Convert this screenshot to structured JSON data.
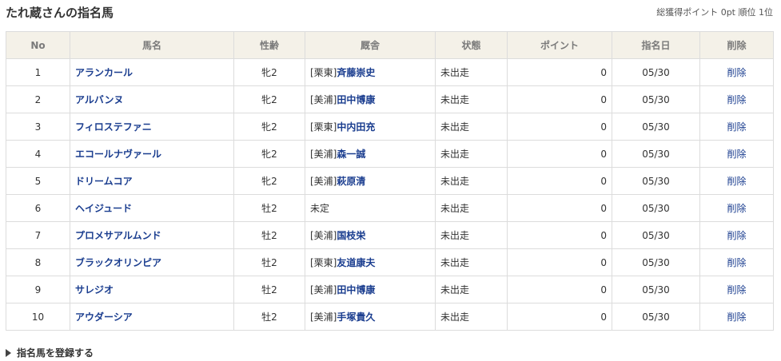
{
  "header": {
    "title": "たれ蔵さんの指名馬",
    "points_label": "総獲得ポイント",
    "points_value": "0pt",
    "rank_label": "順位",
    "rank_value": "1位"
  },
  "table": {
    "columns": [
      "No",
      "馬名",
      "性齢",
      "厩舎",
      "状態",
      "ポイント",
      "指名日",
      "削除"
    ],
    "rows": [
      {
        "no": "1",
        "name": "アランカール",
        "sex": "牝2",
        "region": "[栗東]",
        "trainer": "斉藤崇史",
        "status": "未出走",
        "points": "0",
        "date": "05/30",
        "delete": "削除"
      },
      {
        "no": "2",
        "name": "アルバンヌ",
        "sex": "牝2",
        "region": "[美浦]",
        "trainer": "田中博康",
        "status": "未出走",
        "points": "0",
        "date": "05/30",
        "delete": "削除"
      },
      {
        "no": "3",
        "name": "フィロステファニ",
        "sex": "牝2",
        "region": "[栗東]",
        "trainer": "中内田充",
        "status": "未出走",
        "points": "0",
        "date": "05/30",
        "delete": "削除"
      },
      {
        "no": "4",
        "name": "エコールナヴァール",
        "sex": "牝2",
        "region": "[美浦]",
        "trainer": "森一誠",
        "status": "未出走",
        "points": "0",
        "date": "05/30",
        "delete": "削除"
      },
      {
        "no": "5",
        "name": "ドリームコア",
        "sex": "牝2",
        "region": "[美浦]",
        "trainer": "萩原清",
        "status": "未出走",
        "points": "0",
        "date": "05/30",
        "delete": "削除"
      },
      {
        "no": "6",
        "name": "ヘイジュード",
        "sex": "牡2",
        "region": "未定",
        "trainer": "",
        "status": "未出走",
        "points": "0",
        "date": "05/30",
        "delete": "削除"
      },
      {
        "no": "7",
        "name": "プロメサアルムンド",
        "sex": "牡2",
        "region": "[美浦]",
        "trainer": "国枝栄",
        "status": "未出走",
        "points": "0",
        "date": "05/30",
        "delete": "削除"
      },
      {
        "no": "8",
        "name": "ブラックオリンピア",
        "sex": "牡2",
        "region": "[栗東]",
        "trainer": "友道康夫",
        "status": "未出走",
        "points": "0",
        "date": "05/30",
        "delete": "削除"
      },
      {
        "no": "9",
        "name": "サレジオ",
        "sex": "牡2",
        "region": "[美浦]",
        "trainer": "田中博康",
        "status": "未出走",
        "points": "0",
        "date": "05/30",
        "delete": "削除"
      },
      {
        "no": "10",
        "name": "アウダーシア",
        "sex": "牡2",
        "region": "[美浦]",
        "trainer": "手塚貴久",
        "status": "未出走",
        "points": "0",
        "date": "05/30",
        "delete": "削除"
      }
    ]
  },
  "footer": {
    "register_label": "指名馬を登録する",
    "register_icon": "triangle-right-icon"
  },
  "colors": {
    "link": "#1a3d8f",
    "header_bg": "#f4f1e8",
    "border": "#dcdcdc"
  }
}
